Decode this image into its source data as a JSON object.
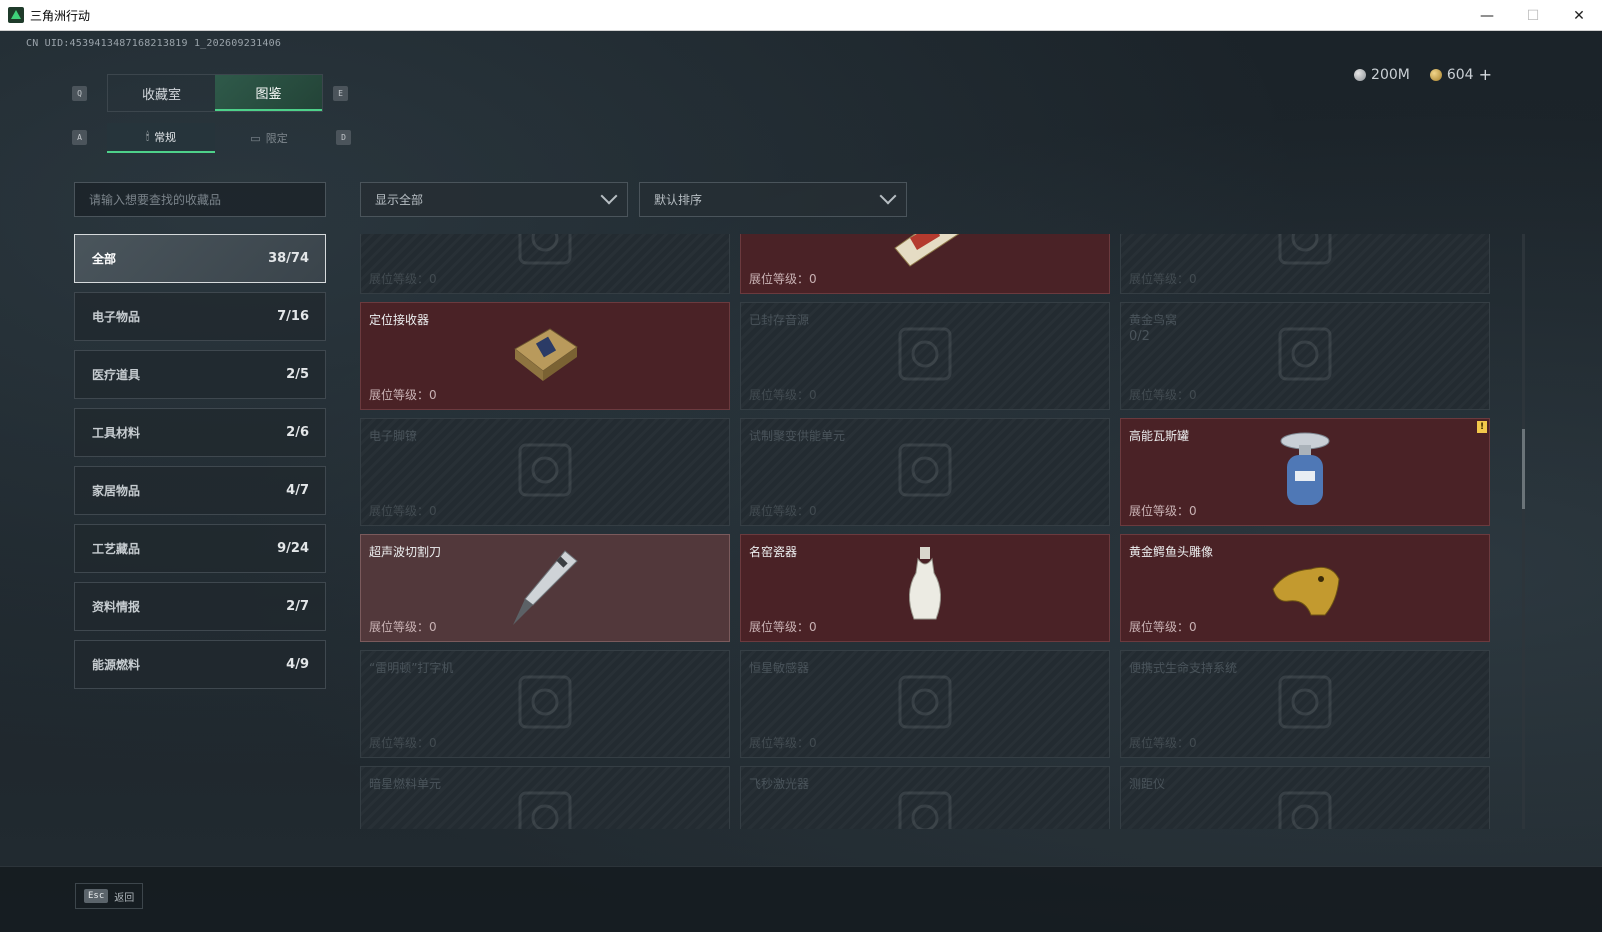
{
  "window": {
    "title": "三角洲行动",
    "controls": [
      "—",
      "☐",
      "✕"
    ]
  },
  "uid": "CN UID:4539413487168213819 1_202609231406",
  "currency": {
    "silver": "200M",
    "gold": "604",
    "plus": "+"
  },
  "hints": {
    "q": "Q",
    "e": "E",
    "a": "A",
    "d": "D"
  },
  "main_tabs": [
    {
      "label": "收藏室",
      "active": false
    },
    {
      "label": "图鉴",
      "active": true
    }
  ],
  "sub_tabs": [
    {
      "label": "常规",
      "icon": "🕯",
      "active": true
    },
    {
      "label": "限定",
      "icon": "▭",
      "active": false
    }
  ],
  "search": {
    "placeholder": "请输入想要查找的收藏品"
  },
  "filter": {
    "display": "显示全部",
    "sort": "默认排序"
  },
  "categories": [
    {
      "label": "全部",
      "count": "38/74"
    },
    {
      "label": "电子物品",
      "count": "7/16"
    },
    {
      "label": "医疗道具",
      "count": "2/5"
    },
    {
      "label": "工具材料",
      "count": "2/6"
    },
    {
      "label": "家居物品",
      "count": "4/7"
    },
    {
      "label": "工艺藏品",
      "count": "9/24"
    },
    {
      "label": "资料情报",
      "count": "2/7"
    },
    {
      "label": "能源燃料",
      "count": "4/9"
    }
  ],
  "level_label": "展位等级：0",
  "cards": [
    {
      "name": "",
      "owned": false,
      "icon": "device-icon"
    },
    {
      "name": "",
      "owned": true,
      "icon": "painting-icon"
    },
    {
      "name": "",
      "owned": false,
      "icon": "frame-icon"
    },
    {
      "name": "定位接收器",
      "owned": true,
      "icon": "receiver-icon"
    },
    {
      "name": "已封存音源",
      "owned": false,
      "icon": "audio-icon"
    },
    {
      "name": "黄金鸟窝",
      "owned": false,
      "sub": "0/2",
      "icon": "nest-icon"
    },
    {
      "name": "电子脚镣",
      "owned": false,
      "icon": "shackle-icon"
    },
    {
      "name": "试制聚变供能单元",
      "owned": false,
      "icon": "fusion-icon"
    },
    {
      "name": "高能瓦斯罐",
      "owned": true,
      "warn": "!",
      "icon": "gas-tank-icon"
    },
    {
      "name": "超声波切割刀",
      "owned": true,
      "highlight": true,
      "icon": "knife-icon"
    },
    {
      "name": "名窑瓷器",
      "owned": true,
      "icon": "vase-icon"
    },
    {
      "name": "黄金鳄鱼头雕像",
      "owned": true,
      "icon": "croc-icon"
    },
    {
      "name": "“雷明顿”打字机",
      "owned": false,
      "icon": "typewriter-icon"
    },
    {
      "name": "恒星敏感器",
      "owned": false,
      "icon": "sensor-icon"
    },
    {
      "name": "便携式生命支持系统",
      "owned": false,
      "icon": "life-support-icon"
    },
    {
      "name": "暗星燃料单元",
      "owned": false,
      "icon": "fuel-icon"
    },
    {
      "name": "飞秒激光器",
      "owned": false,
      "icon": "laser-icon"
    },
    {
      "name": "测距仪",
      "owned": false,
      "icon": "rangefinder-icon"
    }
  ],
  "footer": {
    "key": "Esc",
    "label": "返回"
  },
  "colors": {
    "accent": "#4ed18a",
    "owned_bg": "#4a2226",
    "warn": "#f2c84b"
  }
}
